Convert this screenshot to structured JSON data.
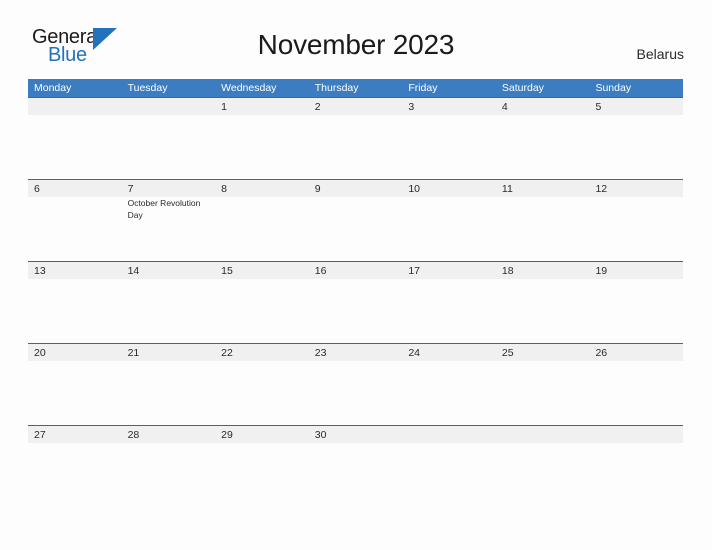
{
  "brand": {
    "name_part1": "General",
    "name_part2": "Blue",
    "triangle_color": "#2272bc"
  },
  "header": {
    "title": "November 2023",
    "country": "Belarus"
  },
  "theme": {
    "header_blue": "#3b7dc0",
    "row_rule_blue": "#2c6ba8",
    "band_gray": "#f0f0f0",
    "page_background": "#fdfdfd",
    "text_color": "#2a2a2a"
  },
  "calendar": {
    "weekdays": [
      "Monday",
      "Tuesday",
      "Wednesday",
      "Thursday",
      "Friday",
      "Saturday",
      "Sunday"
    ],
    "weeks": [
      [
        {
          "date": "",
          "event": ""
        },
        {
          "date": "",
          "event": ""
        },
        {
          "date": "1",
          "event": ""
        },
        {
          "date": "2",
          "event": ""
        },
        {
          "date": "3",
          "event": ""
        },
        {
          "date": "4",
          "event": ""
        },
        {
          "date": "5",
          "event": ""
        }
      ],
      [
        {
          "date": "6",
          "event": ""
        },
        {
          "date": "7",
          "event": "October Revolution Day"
        },
        {
          "date": "8",
          "event": ""
        },
        {
          "date": "9",
          "event": ""
        },
        {
          "date": "10",
          "event": ""
        },
        {
          "date": "11",
          "event": ""
        },
        {
          "date": "12",
          "event": ""
        }
      ],
      [
        {
          "date": "13",
          "event": ""
        },
        {
          "date": "14",
          "event": ""
        },
        {
          "date": "15",
          "event": ""
        },
        {
          "date": "16",
          "event": ""
        },
        {
          "date": "17",
          "event": ""
        },
        {
          "date": "18",
          "event": ""
        },
        {
          "date": "19",
          "event": ""
        }
      ],
      [
        {
          "date": "20",
          "event": ""
        },
        {
          "date": "21",
          "event": ""
        },
        {
          "date": "22",
          "event": ""
        },
        {
          "date": "23",
          "event": ""
        },
        {
          "date": "24",
          "event": ""
        },
        {
          "date": "25",
          "event": ""
        },
        {
          "date": "26",
          "event": ""
        }
      ],
      [
        {
          "date": "27",
          "event": ""
        },
        {
          "date": "28",
          "event": ""
        },
        {
          "date": "29",
          "event": ""
        },
        {
          "date": "30",
          "event": ""
        },
        {
          "date": "",
          "event": ""
        },
        {
          "date": "",
          "event": ""
        },
        {
          "date": "",
          "event": ""
        }
      ]
    ]
  }
}
